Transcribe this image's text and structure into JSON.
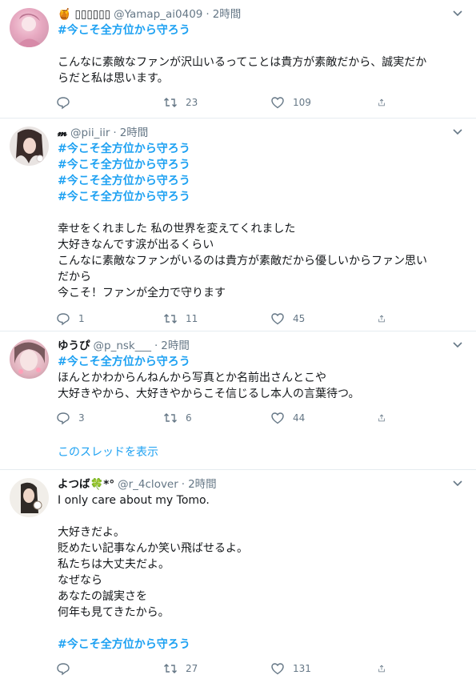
{
  "tweets": [
    {
      "name": "🍯 ▯▯▯▯▯▯",
      "handle": "@Yamap_ai0409",
      "time": "2時間",
      "hashtags": [
        "#今こそ全方位から守ろう"
      ],
      "lines": [
        "",
        "こんなに素敵なファンが沢山いるってことは貴方が素敵だから、誠実だか",
        "らだと私は思います。"
      ],
      "reply": "",
      "retweet": "23",
      "like": "109"
    },
    {
      "name": "𝓶",
      "handle": "@pii_iir",
      "time": "2時間",
      "hashtags": [
        "#今こそ全方位から守ろう",
        "#今こそ全方位から守ろう",
        "#今こそ全方位から守ろう",
        "#今こそ全方位から守ろう"
      ],
      "lines": [
        "",
        "幸せをくれました 私の世界を変えてくれました",
        "大好きなんです涙が出るくらい",
        "こんなに素敵なファンがいるのは貴方が素敵だから優しいからファン思い",
        "だから",
        "今こそ！ファンが全力で守ります"
      ],
      "reply": "1",
      "retweet": "11",
      "like": "45"
    },
    {
      "name": "ゆうぴ",
      "handle": "@p_nsk___",
      "time": "2時間",
      "hashtags": [
        "#今こそ全方位から守ろう"
      ],
      "lines": [
        "ほんとかわからんねんから写真とか名前出さんとこや",
        "大好きやから、大好きやからこそ信じるし本人の言葉待つ。"
      ],
      "reply": "3",
      "retweet": "6",
      "like": "44"
    },
    {
      "name": "よつば🍀*°",
      "handle": "@r_4clover",
      "time": "2時間",
      "hashtags": [],
      "lines": [
        "I only care about my Tomo.",
        "",
        "大好きだよ。",
        "貶めたい記事なんか笑い飛ばせるよ。",
        "私たちは大丈夫だよ。",
        "なぜなら",
        "あなたの誠実さを",
        "何年も見てきたから。",
        ""
      ],
      "trailing_hashtag": "#今こそ全方位から守ろう",
      "reply": "",
      "retweet": "27",
      "like": "131"
    }
  ],
  "thread_link": "このスレッドを表示",
  "icons": {
    "reply": "reply-icon",
    "retweet": "retweet-icon",
    "like": "heart-icon",
    "share": "share-icon",
    "caret": "chevron-down-icon"
  },
  "colors": {
    "link": "#1da1f2",
    "text": "#14171a",
    "secondary": "#657786",
    "border": "#e6ecf0"
  }
}
